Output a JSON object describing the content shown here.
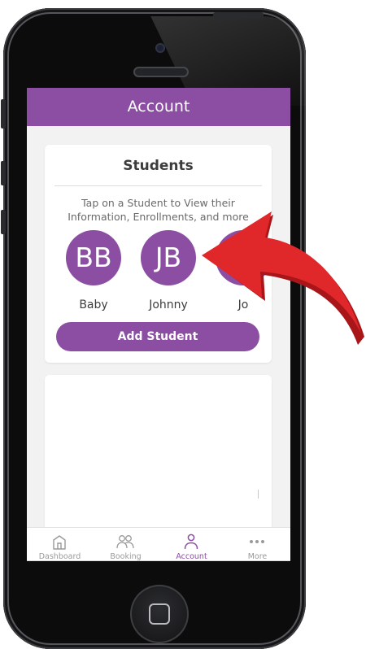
{
  "header": {
    "title": "Account"
  },
  "students_card": {
    "title": "Students",
    "hint_line1": "Tap on a Student to View their",
    "hint_line2": "Information, Enrollments, and more",
    "students": [
      {
        "initials": "BB",
        "name": "Baby"
      },
      {
        "initials": "JB",
        "name": "Johnny"
      },
      {
        "initials": "",
        "name": "Jo"
      }
    ],
    "add_button_label": "Add Student"
  },
  "tabbar": {
    "tabs": [
      {
        "label": "Dashboard",
        "icon": "home-icon"
      },
      {
        "label": "Booking",
        "icon": "people-icon"
      },
      {
        "label": "Account",
        "icon": "person-icon",
        "active": true
      },
      {
        "label": "More",
        "icon": "more-dots-icon"
      }
    ]
  },
  "colors": {
    "brand_purple": "#8b4ea3",
    "arrow_red": "#e0282a",
    "background": "#f2f2f2"
  }
}
